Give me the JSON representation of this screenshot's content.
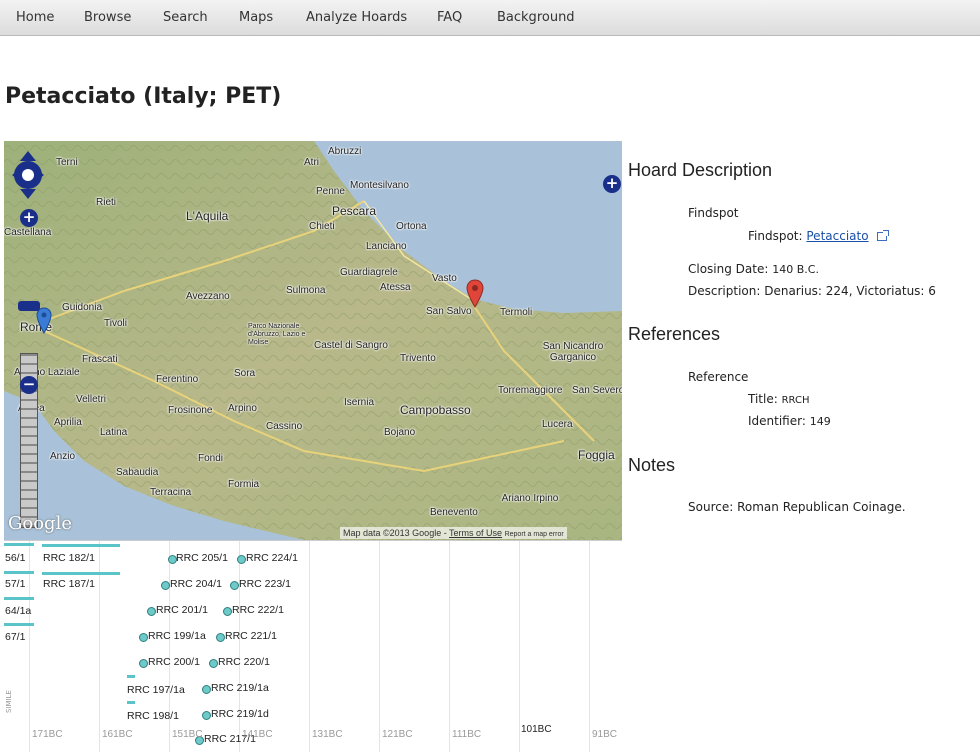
{
  "nav": {
    "items": [
      {
        "label": "Home"
      },
      {
        "label": "Browse"
      },
      {
        "label": "Search"
      },
      {
        "label": "Maps"
      },
      {
        "label": "Analyze Hoards"
      },
      {
        "label": "FAQ"
      },
      {
        "label": "Background"
      }
    ]
  },
  "page": {
    "title": "Petacciato (Italy; PET)"
  },
  "map": {
    "places": [
      "Terni",
      "Rieti",
      "L'Aquila",
      "Penne",
      "Pescara",
      "Chieti",
      "Ortona",
      "Montesilvano",
      "Abruzzi",
      "Lanciano",
      "Guardiagrele",
      "Vasto",
      "Atessa",
      "Sulmona",
      "Avezzano",
      "Guidonia",
      "Tivoli",
      "Rome",
      "Frascati",
      "Albano Laziale",
      "Velletri",
      "Ferentino",
      "Sora",
      "Castel di Sangro",
      "Isernia",
      "Trivento",
      "San Salvo",
      "Termoli",
      "San Nicandro Garganico",
      "Torremaggiore",
      "San Severo",
      "Campobasso",
      "Lucera",
      "Foggia",
      "Bojano",
      "Cassino",
      "Frosinone",
      "Arpino",
      "Aprilia",
      "Latina",
      "Anzio",
      "Fondi",
      "Formia",
      "Sabaudia",
      "Terracina",
      "Benevento",
      "Ariano Irpino",
      "Ardea",
      "Atri",
      "Parco Nazionale d'Abruzzo, Lazio e Molise",
      "Castellana"
    ],
    "google_logo": "Google",
    "attribution": {
      "data": "Map data ©2013 Google -",
      "terms": "Terms of Use",
      "report": "Report a map error"
    }
  },
  "timeline": {
    "left_labels": [
      "56/1",
      "57/1",
      "64/1a",
      "67/1"
    ],
    "left_items": [
      "RRC 182/1",
      "RRC 187/1"
    ],
    "items": [
      "RRC 205/1",
      "RRC 224/1",
      "RRC 204/1",
      "RRC 223/1",
      "RRC 201/1",
      "RRC 222/1",
      "RRC 199/1a",
      "RRC 221/1",
      "RRC 200/1",
      "RRC 220/1",
      "RRC 197/1a",
      "RRC 219/1a",
      "RRC 198/1",
      "RRC 219/1d",
      "RRC 217/1"
    ],
    "ticks": [
      "171BC",
      "161BC",
      "151BC",
      "141BC",
      "131BC",
      "121BC",
      "111BC",
      "101BC",
      "91BC"
    ],
    "side_label": "SIMILE"
  },
  "description": {
    "heading": "Hoard Description",
    "findspot_group": "Findspot",
    "findspot_label": "Findspot:",
    "findspot_value": "Petacciato",
    "closing_label": "Closing Date:",
    "closing_value": "140 B.C.",
    "desc_label": "Description:",
    "desc_value": "Denarius: 224, Victoriatus: 6"
  },
  "references": {
    "heading": "References",
    "group": "Reference",
    "title_label": "Title:",
    "title_value": "RRCH",
    "id_label": "Identifier:",
    "id_value": "149"
  },
  "notes": {
    "heading": "Notes",
    "source_label": "Source:",
    "source_value": "Roman Republican Coinage."
  },
  "colors": {
    "marker_red": "#e0453a",
    "marker_blue": "#3a7bd5",
    "timeline_dot": "#6ec9c9",
    "link": "#1a4ea8"
  }
}
